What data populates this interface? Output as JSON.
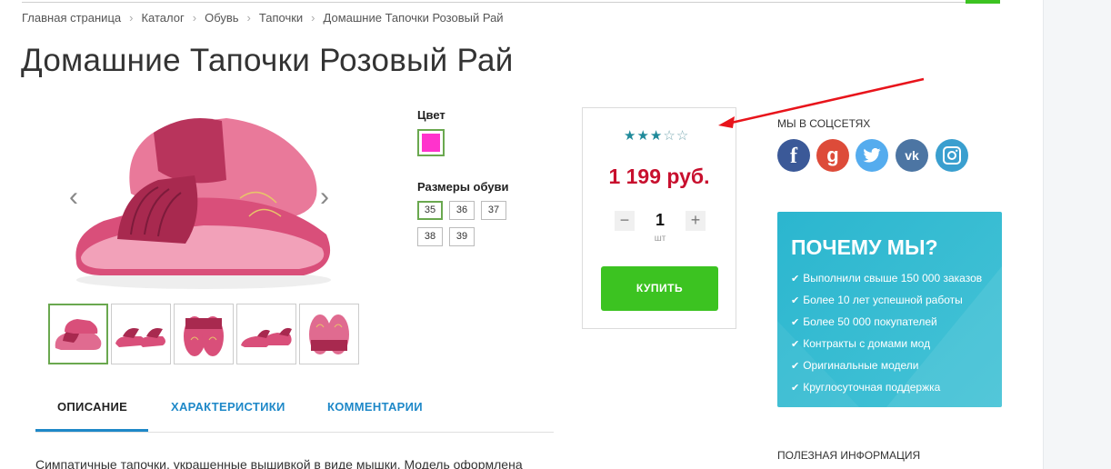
{
  "breadcrumb": {
    "items": [
      "Главная страница",
      "Каталог",
      "Обувь",
      "Тапочки",
      "Домашние Тапочки Розовый Рай"
    ]
  },
  "product": {
    "title": "Домашние Тапочки Розовый Рай",
    "color_label": "Цвет",
    "color_value": "#ff33cc",
    "sizes_label": "Размеры обуви",
    "sizes": [
      "35",
      "36",
      "37",
      "38",
      "39"
    ],
    "selected_size": "35",
    "rating": 3,
    "rating_max": 5,
    "price": "1 199 руб.",
    "quantity": "1",
    "quantity_unit": "шт",
    "qty_minus": "−",
    "qty_plus": "+",
    "buy_label": "КУПИТЬ",
    "thumbnails_count": 5
  },
  "tabs": {
    "description": "ОПИСАНИЕ",
    "characteristics": "ХАРАКТЕРИСТИКИ",
    "comments": "КОММЕНТАРИИ"
  },
  "description_text": "Симпатичные тапочки, украшенные вышивкой в виде мышки. Модель оформлена",
  "sidebar": {
    "social_title": "МЫ В СОЦСЕТЯХ",
    "social": [
      {
        "name": "facebook",
        "glyph": "f"
      },
      {
        "name": "google-plus",
        "glyph": "g"
      },
      {
        "name": "twitter",
        "glyph": "🐦"
      },
      {
        "name": "vk",
        "glyph": "vk"
      },
      {
        "name": "instagram",
        "glyph": ""
      }
    ],
    "why_title": "ПОЧЕМУ МЫ?",
    "why_items": [
      "Выполнили свыше 150 000 заказов",
      "Более 10 лет успешной работы",
      "Более 50 000 покупателей",
      "Контракты с домами мод",
      "Оригинальные модели",
      "Круглосуточная поддержка"
    ],
    "useful_title": "ПОЛЕЗНАЯ ИНФОРМАЦИЯ"
  },
  "colors": {
    "accent_green": "#3cc321",
    "price_red": "#c8102e",
    "tab_blue": "#1e88c8",
    "annotation_red": "#e8141b"
  }
}
